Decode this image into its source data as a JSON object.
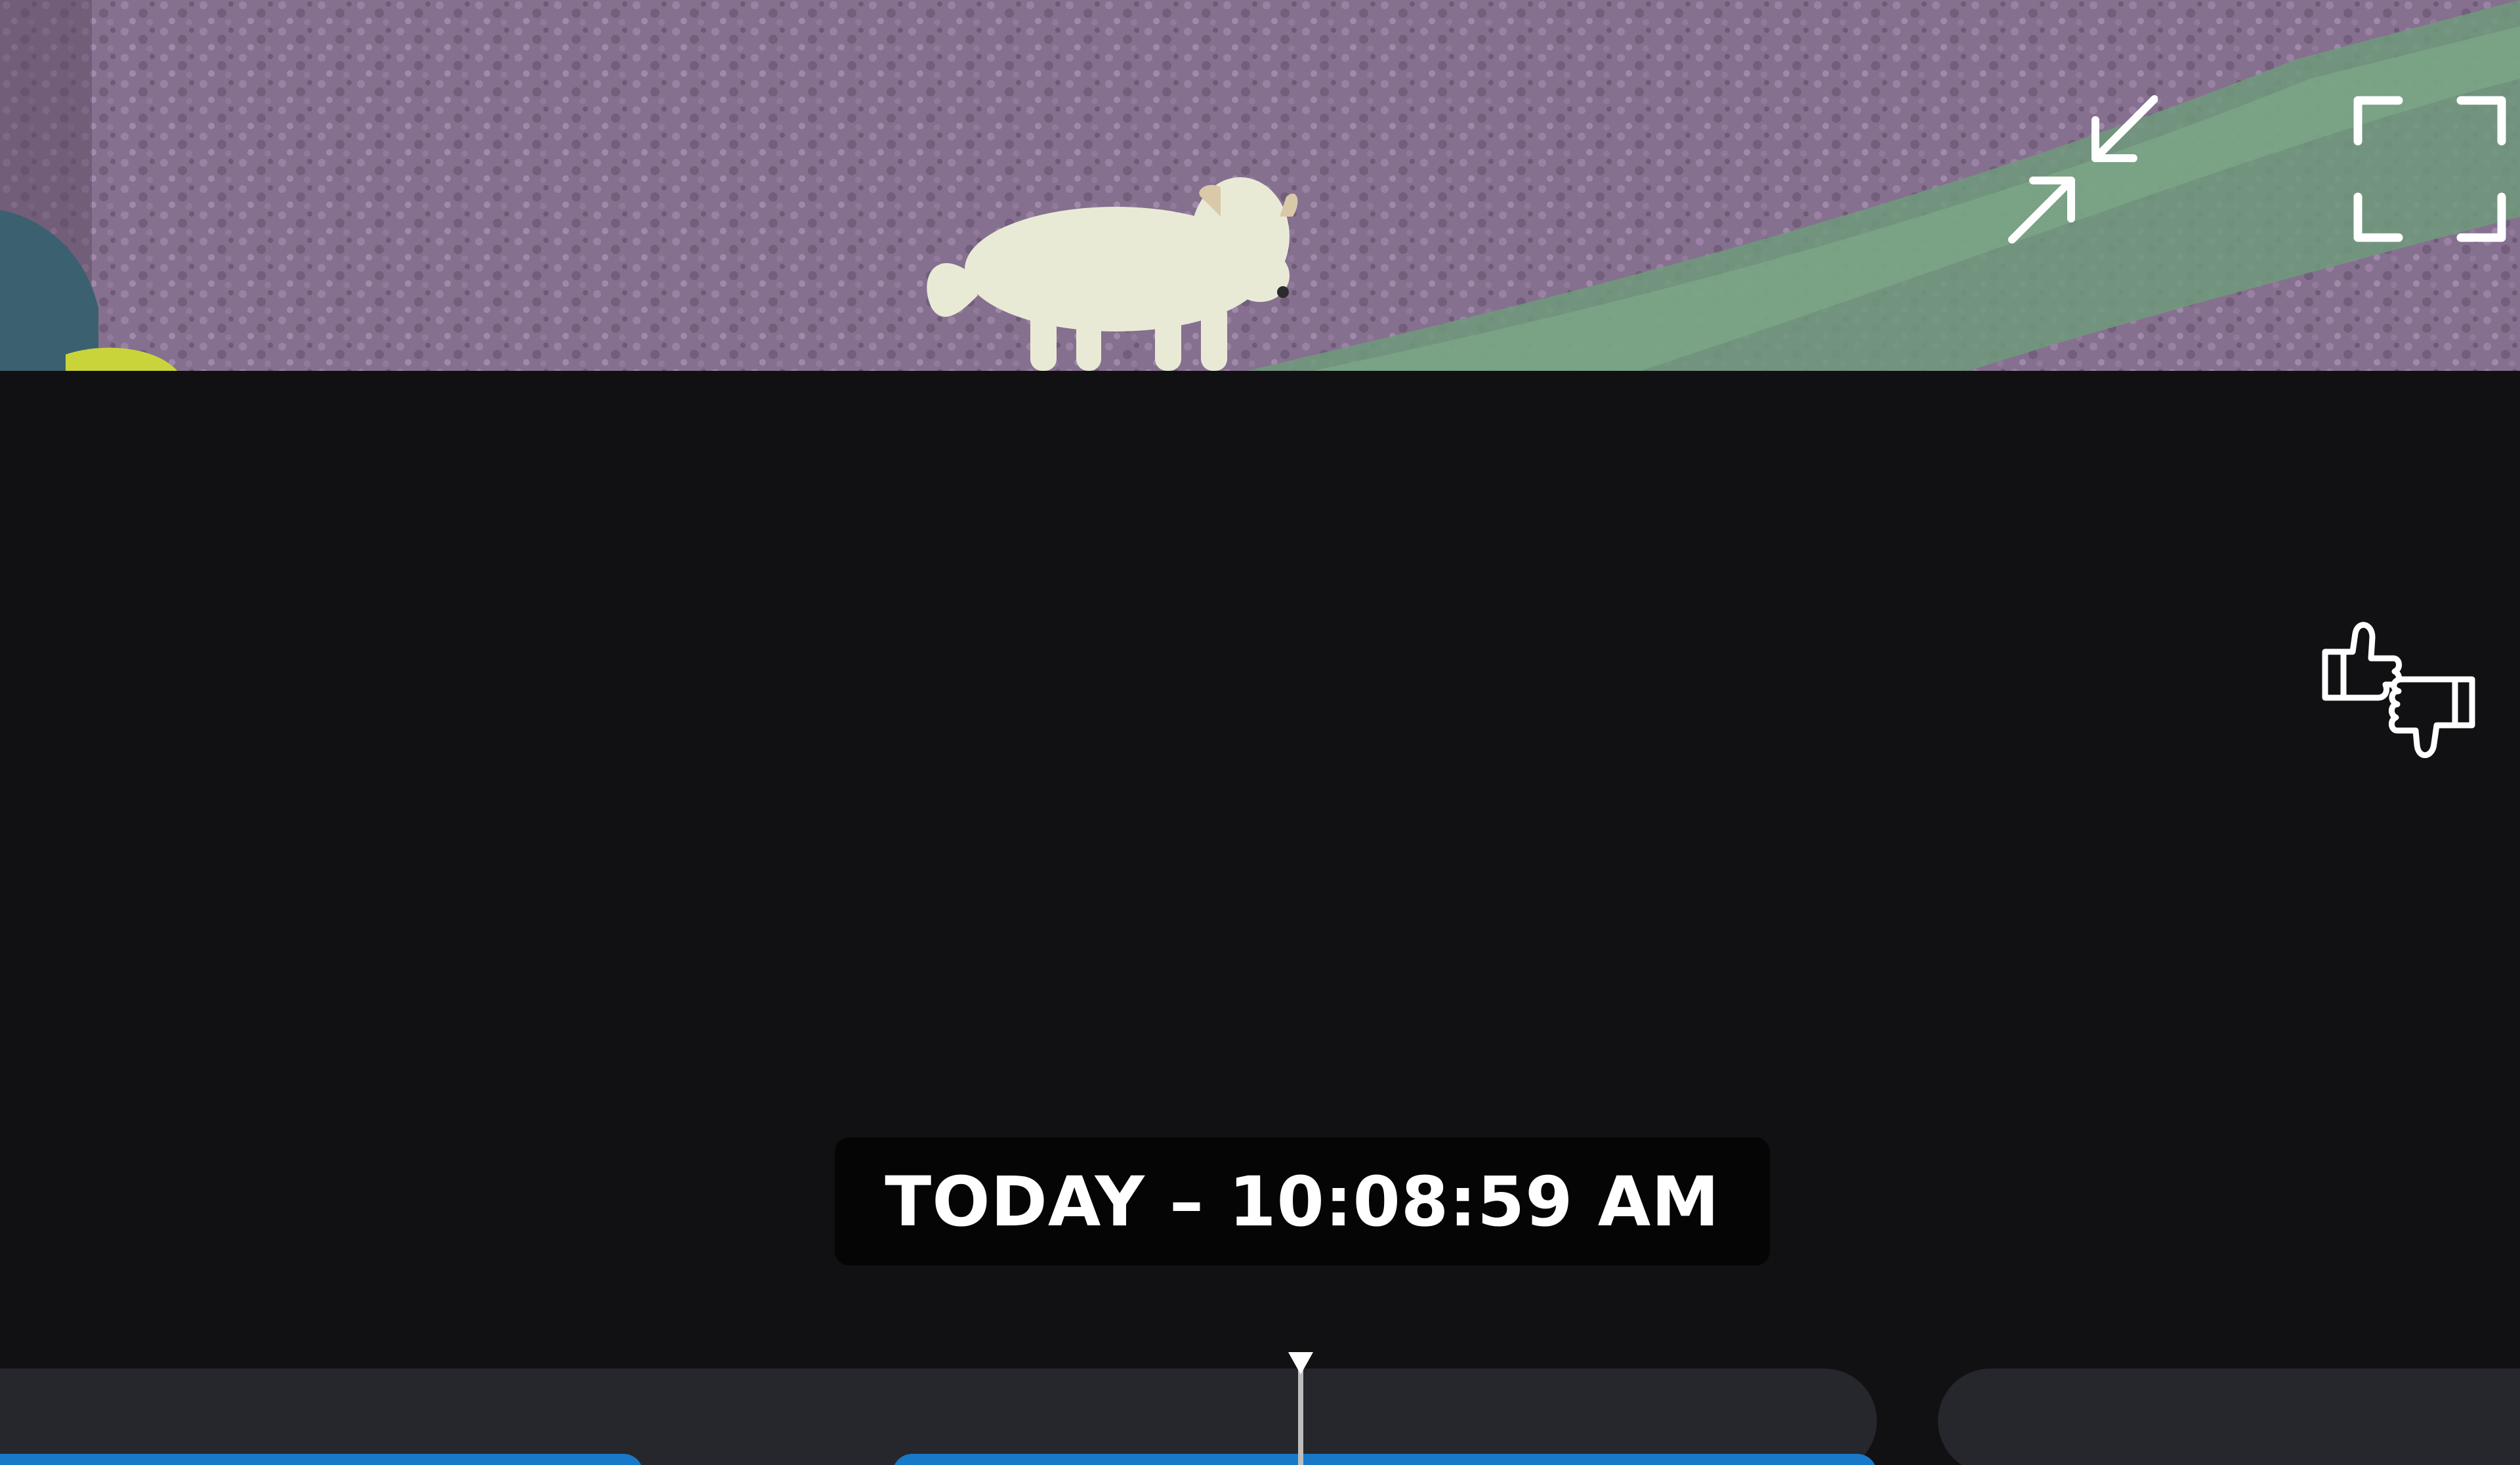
{
  "player": {
    "timestamp": "TODAY – 10:08:59 AM"
  },
  "controls": {
    "minimize_icon": "arrows-collapse-icon",
    "fullscreen_icon": "fullscreen-corners-icon",
    "feedback_icon": "thumbs-up-down-icon"
  },
  "colors": {
    "background": "#111113",
    "timeline_track": "#26272c",
    "timeline_clip": "#1879c9",
    "timestamp_bg": "#050506",
    "text": "#ffffff"
  }
}
